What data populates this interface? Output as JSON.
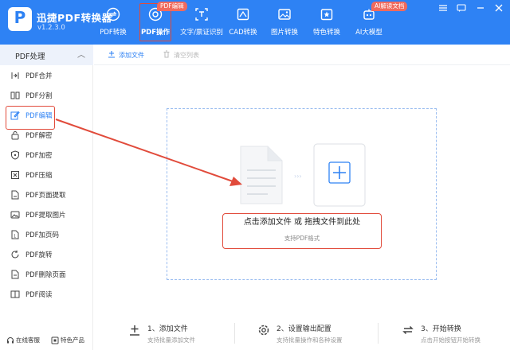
{
  "app": {
    "logo_letter": "P",
    "title": "迅捷PDF转换器",
    "version": "v1.2.3.0"
  },
  "nav": {
    "items": [
      {
        "label": "PDF转换",
        "icon": "convert-icon"
      },
      {
        "label": "PDF操作",
        "icon": "pdf-operate-icon",
        "active": true
      },
      {
        "label": "文字/票证识别",
        "icon": "ocr-icon"
      },
      {
        "label": "CAD转换",
        "icon": "cad-icon"
      },
      {
        "label": "图片转换",
        "icon": "image-icon"
      },
      {
        "label": "特色转换",
        "icon": "star-convert-icon"
      },
      {
        "label": "AI大模型",
        "icon": "robot-icon"
      }
    ],
    "badge_pdf": "PDF编辑",
    "badge_ai": "AI解读文档"
  },
  "window_controls": [
    "menu-icon",
    "message-icon",
    "minimize-icon",
    "close-icon"
  ],
  "sidebar": {
    "header": "PDF处理",
    "items": [
      {
        "label": "PDF合并",
        "icon": "merge-icon"
      },
      {
        "label": "PDF分割",
        "icon": "split-icon"
      },
      {
        "label": "PDF编辑",
        "icon": "edit-icon",
        "selected": true
      },
      {
        "label": "PDF解密",
        "icon": "unlock-icon"
      },
      {
        "label": "PDF加密",
        "icon": "shield-icon"
      },
      {
        "label": "PDF压缩",
        "icon": "compress-icon"
      },
      {
        "label": "PDF页面提取",
        "icon": "page-extract-icon"
      },
      {
        "label": "PDF提取图片",
        "icon": "image-extract-icon"
      },
      {
        "label": "PDF加页码",
        "icon": "page-number-icon"
      },
      {
        "label": "PDF旋转",
        "icon": "rotate-icon"
      },
      {
        "label": "PDF删除页面",
        "icon": "delete-page-icon"
      },
      {
        "label": "PDF阅读",
        "icon": "read-icon"
      }
    ],
    "footer": {
      "online_service": "在线客服",
      "featured_products": "特色产品"
    }
  },
  "toolbar": {
    "add_file": "添加文件",
    "clear_list": "清空列表"
  },
  "dropzone": {
    "main_text": "点击添加文件 或 拖拽文件到此处",
    "sub_text": "支持PDF格式"
  },
  "steps": [
    {
      "title": "1、添加文件",
      "desc": "支持批量添加文件"
    },
    {
      "title": "2、设置输出配置",
      "desc": "支持批量操作和各种设置"
    },
    {
      "title": "3、开始转换",
      "desc": "点击开始按钮开始转换"
    }
  ],
  "colors": {
    "brand_blue": "#2e82f4",
    "highlight_red": "#e14b3b",
    "badge_red": "#f06a5d",
    "sidebar_header_bg": "#edf2fb"
  }
}
